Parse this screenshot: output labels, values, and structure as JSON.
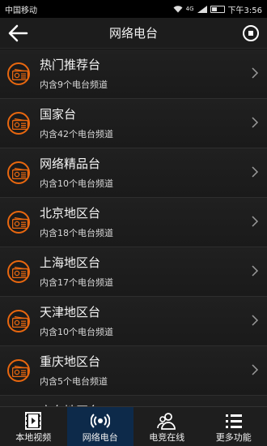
{
  "status_bar": {
    "carrier": "中国移动",
    "network": "4G",
    "time": "下午3:56"
  },
  "header": {
    "title": "网络电台",
    "back_icon": "arrow-left-icon",
    "stop_icon": "stop-circle-icon"
  },
  "stations": [
    {
      "name": "热门推荐台",
      "subtitle": "内含9个电台频道"
    },
    {
      "name": "国家台",
      "subtitle": "内含42个电台频道"
    },
    {
      "name": "网络精品台",
      "subtitle": "内含10个电台频道"
    },
    {
      "name": "北京地区台",
      "subtitle": "内含18个电台频道"
    },
    {
      "name": "上海地区台",
      "subtitle": "内含17个电台频道"
    },
    {
      "name": "天津地区台",
      "subtitle": "内含10个电台频道"
    },
    {
      "name": "重庆地区台",
      "subtitle": "内含5个电台频道"
    },
    {
      "name": "广东地区台",
      "subtitle": ""
    }
  ],
  "tabs": [
    {
      "label": "本地视频",
      "icon": "film-icon",
      "active": false
    },
    {
      "label": "网络电台",
      "icon": "radio-wave-icon",
      "active": true
    },
    {
      "label": "电竞在线",
      "icon": "users-icon",
      "active": false
    },
    {
      "label": "更多功能",
      "icon": "menu-list-icon",
      "active": false
    }
  ],
  "colors": {
    "accent": "#e8670f",
    "active_tab": "#0d2a4a",
    "background": "#161616"
  }
}
